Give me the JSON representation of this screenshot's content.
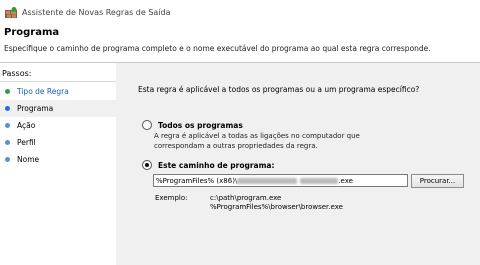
{
  "window": {
    "title": "Assistente de Novas Regras de Saída"
  },
  "header": {
    "heading": "Programa",
    "description": "Especifique o caminho de programa completo e o nome executável do programa ao qual esta regra corresponde."
  },
  "sidebar": {
    "title": "Passos:",
    "items": [
      {
        "label": "Tipo de Regra",
        "state": "done"
      },
      {
        "label": "Programa",
        "state": "current"
      },
      {
        "label": "Ação",
        "state": "pending"
      },
      {
        "label": "Perfil",
        "state": "pending"
      },
      {
        "label": "Nome",
        "state": "pending"
      }
    ]
  },
  "main": {
    "intro": "Esta regra é aplicável a todos os programas ou a um programa específico?",
    "option_all": {
      "label": "Todos os programas",
      "description": "A regra é aplicável a todas as ligações no computador que correspondam a outras propriedades da regra.",
      "checked": false
    },
    "option_path": {
      "label": "Este caminho de programa:",
      "checked": true
    },
    "path_value": "%ProgramFiles% (x86)\\",
    "path_suffix": ".exe",
    "browse_label": "Procurar...",
    "example_label": "Exemplo:",
    "example_1": "c:\\path\\program.exe",
    "example_2": "%ProgramFiles%\\browser\\browser.exe"
  },
  "colors": {
    "done_bullet": "#2e9e3a",
    "current_bullet": "#1e6fd0",
    "pending_bullet": "#5b8fd6",
    "link_text": "#1a5fb4"
  }
}
